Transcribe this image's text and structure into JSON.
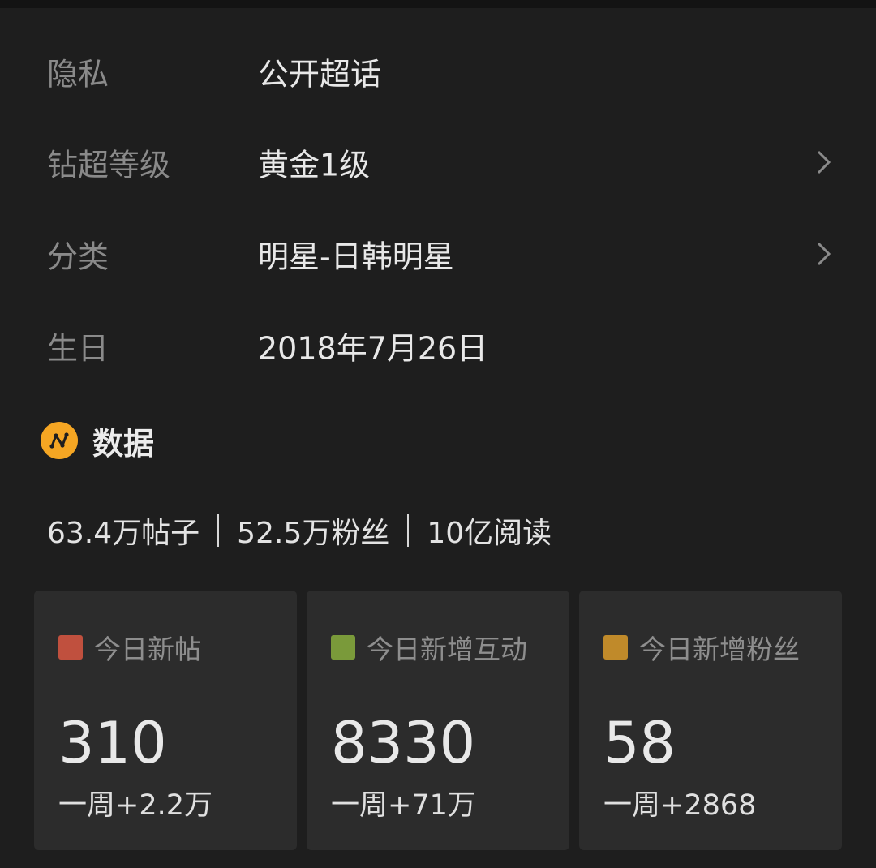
{
  "info": {
    "privacy": {
      "label": "隐私",
      "value": "公开超话"
    },
    "level": {
      "label": "钻超等级",
      "value": "黄金1级"
    },
    "category": {
      "label": "分类",
      "value": "明星-日韩明星"
    },
    "birthday": {
      "label": "生日",
      "value": "2018年7月26日"
    }
  },
  "data_section": {
    "title": "数据",
    "icon": "chart-line-icon",
    "accent_color": "#f5a623"
  },
  "stats": {
    "posts": "63.4万帖子",
    "fans": "52.5万粉丝",
    "reads": "10亿阅读"
  },
  "cards": [
    {
      "label": "今日新帖",
      "value": "310",
      "sub": "一周+2.2万",
      "color": "#c0503e"
    },
    {
      "label": "今日新增互动",
      "value": "8330",
      "sub": "一周+71万",
      "color": "#7a9a3a"
    },
    {
      "label": "今日新增粉丝",
      "value": "58",
      "sub": "一周+2868",
      "color": "#c08a2a"
    }
  ]
}
